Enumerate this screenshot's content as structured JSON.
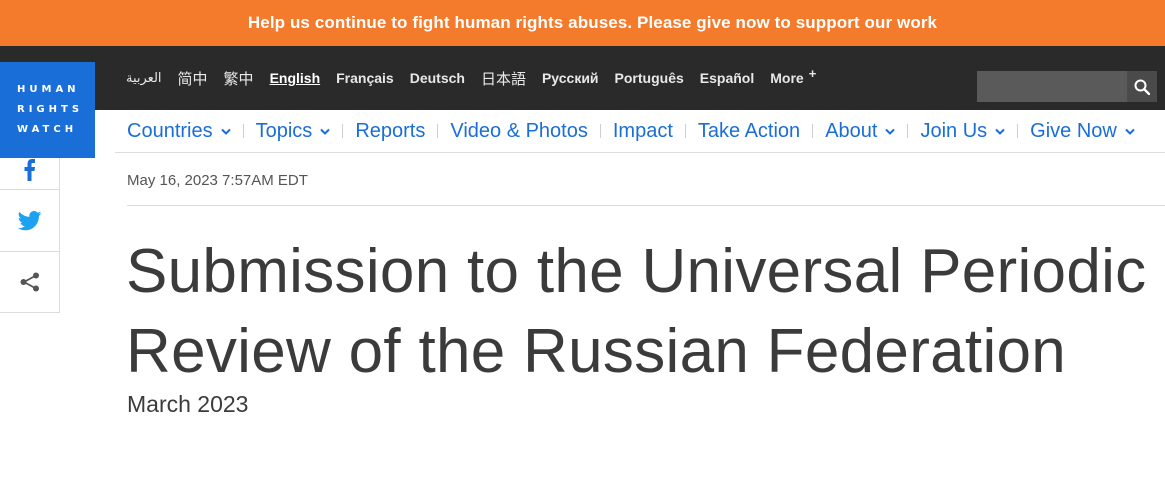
{
  "banner": {
    "text": "Help us continue to fight human rights abuses. Please give now to support our work"
  },
  "languages": {
    "arabic": "العربية",
    "simplified_chinese": "简中",
    "traditional_chinese": "繁中",
    "english": "English",
    "french": "Français",
    "german": "Deutsch",
    "japanese": "日本語",
    "russian": "Русский",
    "portuguese": "Português",
    "spanish": "Español",
    "more": "More",
    "more_symbol": "+"
  },
  "search": {
    "placeholder": "",
    "icon": "search-icon"
  },
  "logo": {
    "line1": "HUMAN",
    "line2": "RIGHTS",
    "line3": "WATCH",
    "color": "#1a6ed8"
  },
  "nav": {
    "countries": "Countries",
    "topics": "Topics",
    "reports": "Reports",
    "video_photos": "Video & Photos",
    "impact": "Impact",
    "take_action": "Take Action",
    "about": "About",
    "join_us": "Join Us",
    "give_now": "Give Now"
  },
  "social": {
    "facebook": "facebook-icon",
    "twitter": "twitter-icon",
    "share": "share-icon"
  },
  "article": {
    "date": "May 16, 2023 7:57AM EDT",
    "title_line1": "Submission to the Universal Periodic",
    "title_line2": "Review of the Russian Federation",
    "subtitle": "March 2023"
  },
  "colors": {
    "banner": "#f47a2c",
    "topbar": "#2a2a2a",
    "accent": "#1a6ed8",
    "twitter": "#1da1f2",
    "text": "#3b3b3b"
  }
}
